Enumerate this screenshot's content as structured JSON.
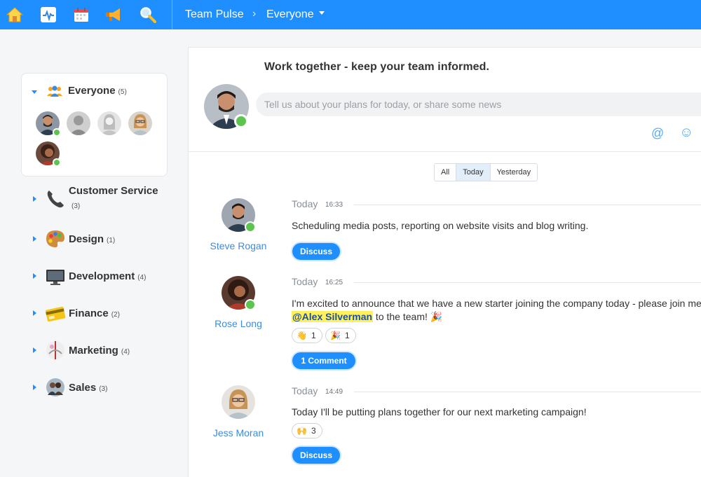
{
  "topbar": {
    "icons": [
      "home-icon",
      "activity-icon",
      "calendar-icon",
      "megaphone-icon",
      "search-icon"
    ],
    "breadcrumb_root": "Team Pulse",
    "breadcrumb_current": "Everyone",
    "accent": "#1f8fff"
  },
  "sidebar": {
    "everyone": {
      "label": "Everyone",
      "count": "(5)"
    },
    "groups": [
      {
        "label": "Customer Service",
        "count": "(3)",
        "icon": "phone-icon"
      },
      {
        "label": "Design",
        "count": "(1)",
        "icon": "palette-icon"
      },
      {
        "label": "Development",
        "count": "(4)",
        "icon": "monitor-icon"
      },
      {
        "label": "Finance",
        "count": "(2)",
        "icon": "credit-card-icon"
      },
      {
        "label": "Marketing",
        "count": "(4)",
        "icon": "marketing-icon"
      },
      {
        "label": "Sales",
        "count": "(3)",
        "icon": "sales-icon"
      }
    ]
  },
  "composer": {
    "title": "Work together - keep your team informed.",
    "placeholder": "Tell us about your plans for today, or share some news",
    "mention_symbol": "@",
    "emoji_symbol": "☺"
  },
  "filter": {
    "options": [
      "All",
      "Today",
      "Yesterday"
    ],
    "active": "Today"
  },
  "posts": [
    {
      "author": "Steve Rogan",
      "day": "Today",
      "time": "16:33",
      "text": "Scheduling media posts, reporting on website visits and blog writing.",
      "button": "Discuss"
    },
    {
      "author": "Rose Long",
      "day": "Today",
      "time": "16:25",
      "text_line1": "I'm excited to announce that we have a new starter joining the company today - please join me",
      "mention": "@Alex Silverman",
      "text_line2": " to the team! 🎉",
      "reactions": [
        {
          "emoji": "👋",
          "count": "1"
        },
        {
          "emoji": "🎉",
          "count": "1"
        }
      ],
      "button": "1 Comment"
    },
    {
      "author": "Jess Moran",
      "day": "Today",
      "time": "14:49",
      "text": "Today I'll be putting plans together for our next marketing campaign!",
      "reactions": [
        {
          "emoji": "🙌",
          "count": "3"
        }
      ],
      "button": "Discuss"
    }
  ]
}
